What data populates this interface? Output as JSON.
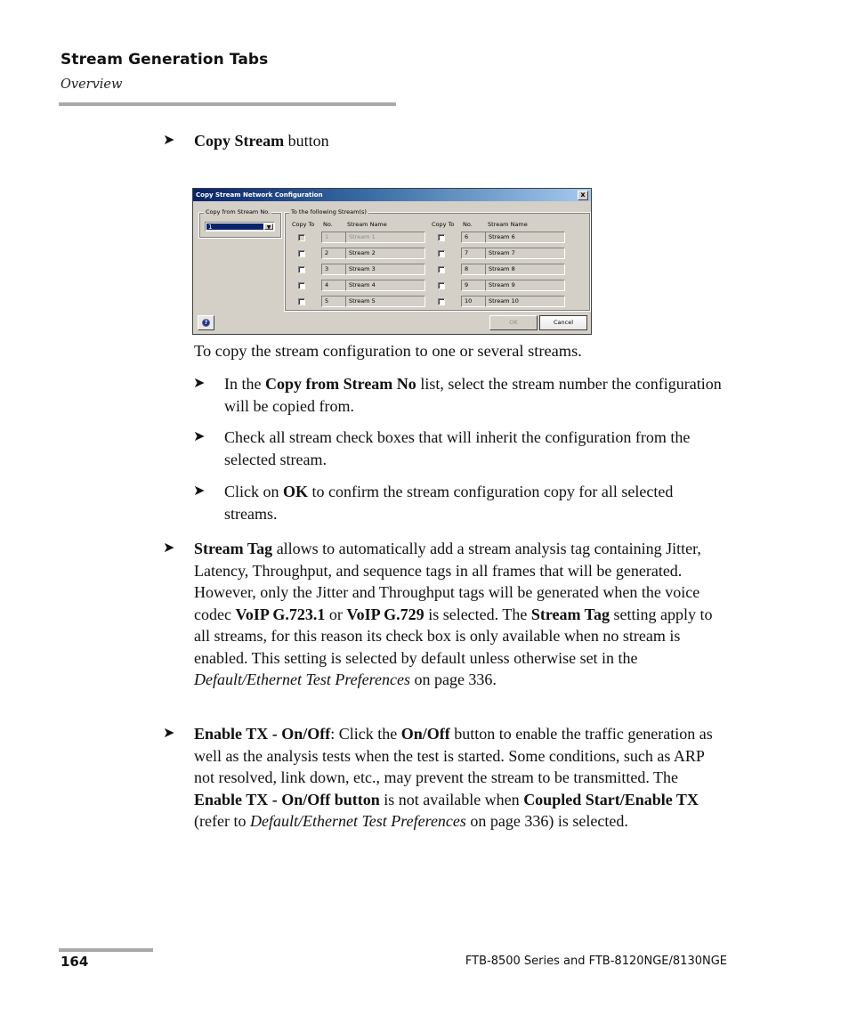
{
  "header": {
    "title": "Stream Generation Tabs",
    "subtitle": "Overview"
  },
  "intro_bullet": {
    "bold": "Copy Stream",
    "rest": " button"
  },
  "dialog": {
    "title": "Copy Stream Network Configuration",
    "close_label": "x",
    "copy_from_label": "Copy from Stream No.",
    "copy_from_value": "1",
    "group_label": "To the following Stream(s)",
    "col_copy_to": "Copy To",
    "col_no": "No.",
    "col_name": "Stream Name",
    "streams": [
      {
        "no": "1",
        "name": "Stream 1",
        "disabled": true
      },
      {
        "no": "2",
        "name": "Stream 2",
        "disabled": false
      },
      {
        "no": "3",
        "name": "Stream 3",
        "disabled": false
      },
      {
        "no": "4",
        "name": "Stream 4",
        "disabled": false
      },
      {
        "no": "5",
        "name": "Stream 5",
        "disabled": false
      },
      {
        "no": "6",
        "name": "Stream 6",
        "disabled": false
      },
      {
        "no": "7",
        "name": "Stream 7",
        "disabled": false
      },
      {
        "no": "8",
        "name": "Stream 8",
        "disabled": false
      },
      {
        "no": "9",
        "name": "Stream 9",
        "disabled": false
      },
      {
        "no": "10",
        "name": "Stream 10",
        "disabled": false
      }
    ],
    "ok_label": "OK",
    "cancel_label": "Cancel",
    "help_icon": "help-icon"
  },
  "body": {
    "copy_intro": "To copy the stream configuration to one or several streams.",
    "sub_bullets": [
      {
        "t1": "In the ",
        "b1": "Copy from Stream No",
        "t2": " list, select the stream number the configuration will be copied from."
      },
      {
        "t1": "Check all stream check boxes that will inherit the configuration from the selected stream."
      },
      {
        "t1": "Click on ",
        "b1": "OK",
        "t2": " to confirm the stream configuration copy for all selected streams."
      }
    ],
    "stream_tag": {
      "b1": "Stream Tag",
      "t1": " allows to automatically add a stream analysis tag containing Jitter, Latency, Throughput, and sequence tags in all frames that will be generated. However, only the Jitter and Throughput tags will be generated when the voice codec ",
      "b2": "VoIP G.723.1",
      "t2": " or ",
      "b3": "VoIP G.729",
      "t3": " is selected. The ",
      "b4": "Stream Tag",
      "t4": " setting apply to all streams, for this reason its check box is only available when no stream is enabled. This setting is selected by default unless otherwise set in the ",
      "i1": "Default/Ethernet Test Preferences",
      "t5": " on page 336."
    },
    "enable_tx": {
      "b1": "Enable TX - On/Off",
      "t1": ": Click the ",
      "b2": "On/Off",
      "t2": " button to enable the traffic generation as well as the analysis tests when the test is started. Some conditions, such as ARP not resolved, link down, etc., may prevent the stream to be transmitted. The ",
      "b3": "Enable TX - On/Off button",
      "t3": " is not available when ",
      "b4": "Coupled Start/Enable TX",
      "t4": " (refer to ",
      "i1": "Default/Ethernet Test Preferences",
      "t5": " on page 336) is selected."
    }
  },
  "footer": {
    "page_number": "164",
    "doc_title": "FTB-8500 Series and FTB-8120NGE/8130NGE"
  }
}
